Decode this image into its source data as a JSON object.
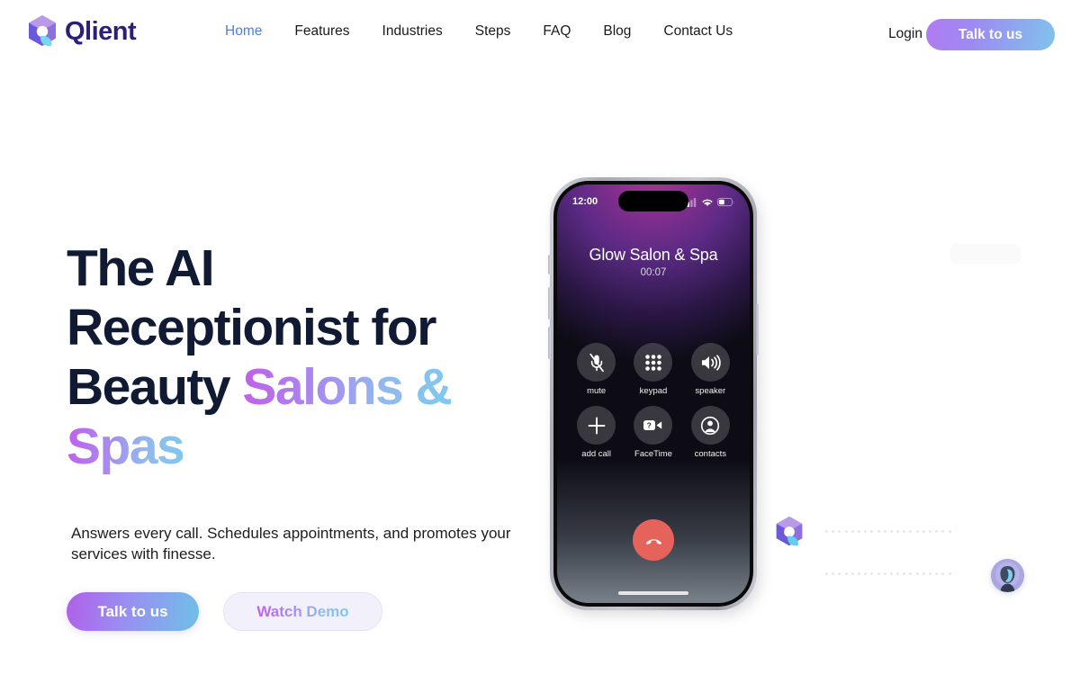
{
  "header": {
    "brand_name": "Qlient",
    "nav_items": [
      {
        "label": "Home",
        "active": true
      },
      {
        "label": "Features",
        "active": false
      },
      {
        "label": "Industries",
        "active": false
      },
      {
        "label": "Steps",
        "active": false
      },
      {
        "label": "FAQ",
        "active": false
      },
      {
        "label": "Blog",
        "active": false
      },
      {
        "label": "Contact Us",
        "active": false
      }
    ],
    "login_label": "Login",
    "cta_label": "Talk to us"
  },
  "hero": {
    "headline_line1": "The AI",
    "headline_line2": "Receptionist for",
    "headline_line3_plain": "Beauty ",
    "headline_line3_grad": "Salons &",
    "headline_line4_grad": "Spas",
    "subhead": "Answers every call. Schedules appointments, and promotes your services with finesse.",
    "primary_button": "Talk to us",
    "secondary_button": "Watch Demo"
  },
  "phone": {
    "status_time": "12:00",
    "caller_name": "Glow Salon & Spa",
    "call_timer": "00:07",
    "controls": [
      {
        "label": "mute",
        "icon": "mic-muted-icon"
      },
      {
        "label": "keypad",
        "icon": "keypad-icon"
      },
      {
        "label": "speaker",
        "icon": "speaker-icon"
      },
      {
        "label": "add call",
        "icon": "plus-icon"
      },
      {
        "label": "FaceTime",
        "icon": "facetime-video-icon"
      },
      {
        "label": "contacts",
        "icon": "contacts-person-icon"
      }
    ],
    "end_call_icon": "end-call-icon",
    "status_icons": [
      "cellular-signal-icon",
      "wifi-icon",
      "battery-icon"
    ]
  },
  "colors": {
    "brand_navy": "#2b1f7a",
    "headline_navy": "#101a33",
    "nav_active": "#4a7fe8",
    "gradient_start": "#b05fe8",
    "gradient_end": "#6fc0e8",
    "end_call_red": "#e5635a",
    "secondary_btn_bg": "#f2f1fb"
  }
}
